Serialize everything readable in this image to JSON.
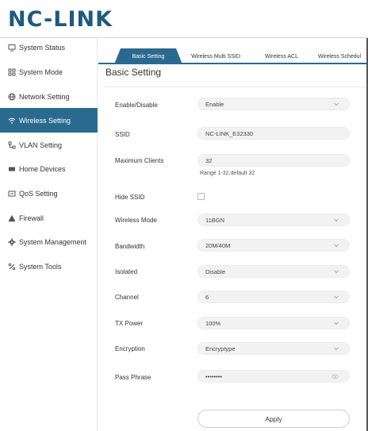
{
  "brand": {
    "logo_text": "NC-LINK"
  },
  "sidebar": {
    "items": [
      {
        "label": "System Status",
        "icon": "monitor-icon"
      },
      {
        "label": "System Mode",
        "icon": "grid-icon"
      },
      {
        "label": "Network Setting",
        "icon": "globe-icon"
      },
      {
        "label": "Wireless Setting",
        "icon": "wifi-icon",
        "active": true
      },
      {
        "label": "VLAN Setting",
        "icon": "vlan-icon"
      },
      {
        "label": "Home Devices",
        "icon": "devices-icon"
      },
      {
        "label": "QoS Setting",
        "icon": "qos-icon"
      },
      {
        "label": "Firewall",
        "icon": "firewall-icon"
      },
      {
        "label": "System Management",
        "icon": "gear-icon"
      },
      {
        "label": "System Tools",
        "icon": "tools-icon"
      }
    ]
  },
  "tabs": [
    {
      "label": "Basic Setting",
      "active": true
    },
    {
      "label": "Wireless Multi SSID"
    },
    {
      "label": "Wireless ACL"
    },
    {
      "label": "Wireless Schedul"
    }
  ],
  "page_title": "Basic Setting",
  "form": {
    "enable": {
      "label": "Enable/Disable",
      "value": "Enable"
    },
    "ssid": {
      "label": "SSID",
      "value": "NC-LINK_E32330"
    },
    "max_clients": {
      "label": "Maximum Clients",
      "value": "32",
      "hint": "Range 1-32,default 32"
    },
    "hide_ssid": {
      "label": "Hide SSID",
      "checked": false
    },
    "wireless_mode": {
      "label": "Wireless Mode",
      "value": "11BGN"
    },
    "bandwidth": {
      "label": "Bandwidth",
      "value": "20M/40M"
    },
    "isolated": {
      "label": "Isolated",
      "value": "Disable"
    },
    "channel": {
      "label": "Channel",
      "value": "6"
    },
    "tx_power": {
      "label": "TX Power",
      "value": "100%"
    },
    "encryption": {
      "label": "Encryption",
      "value": "Encryptype"
    },
    "pass_phrase": {
      "label": "Pass Phrase",
      "value": "••••••••"
    }
  },
  "apply_label": "Apply",
  "colors": {
    "accent": "#2b6a8f",
    "logo": "#1e5a7e",
    "field_bg": "#f2f2f2"
  }
}
